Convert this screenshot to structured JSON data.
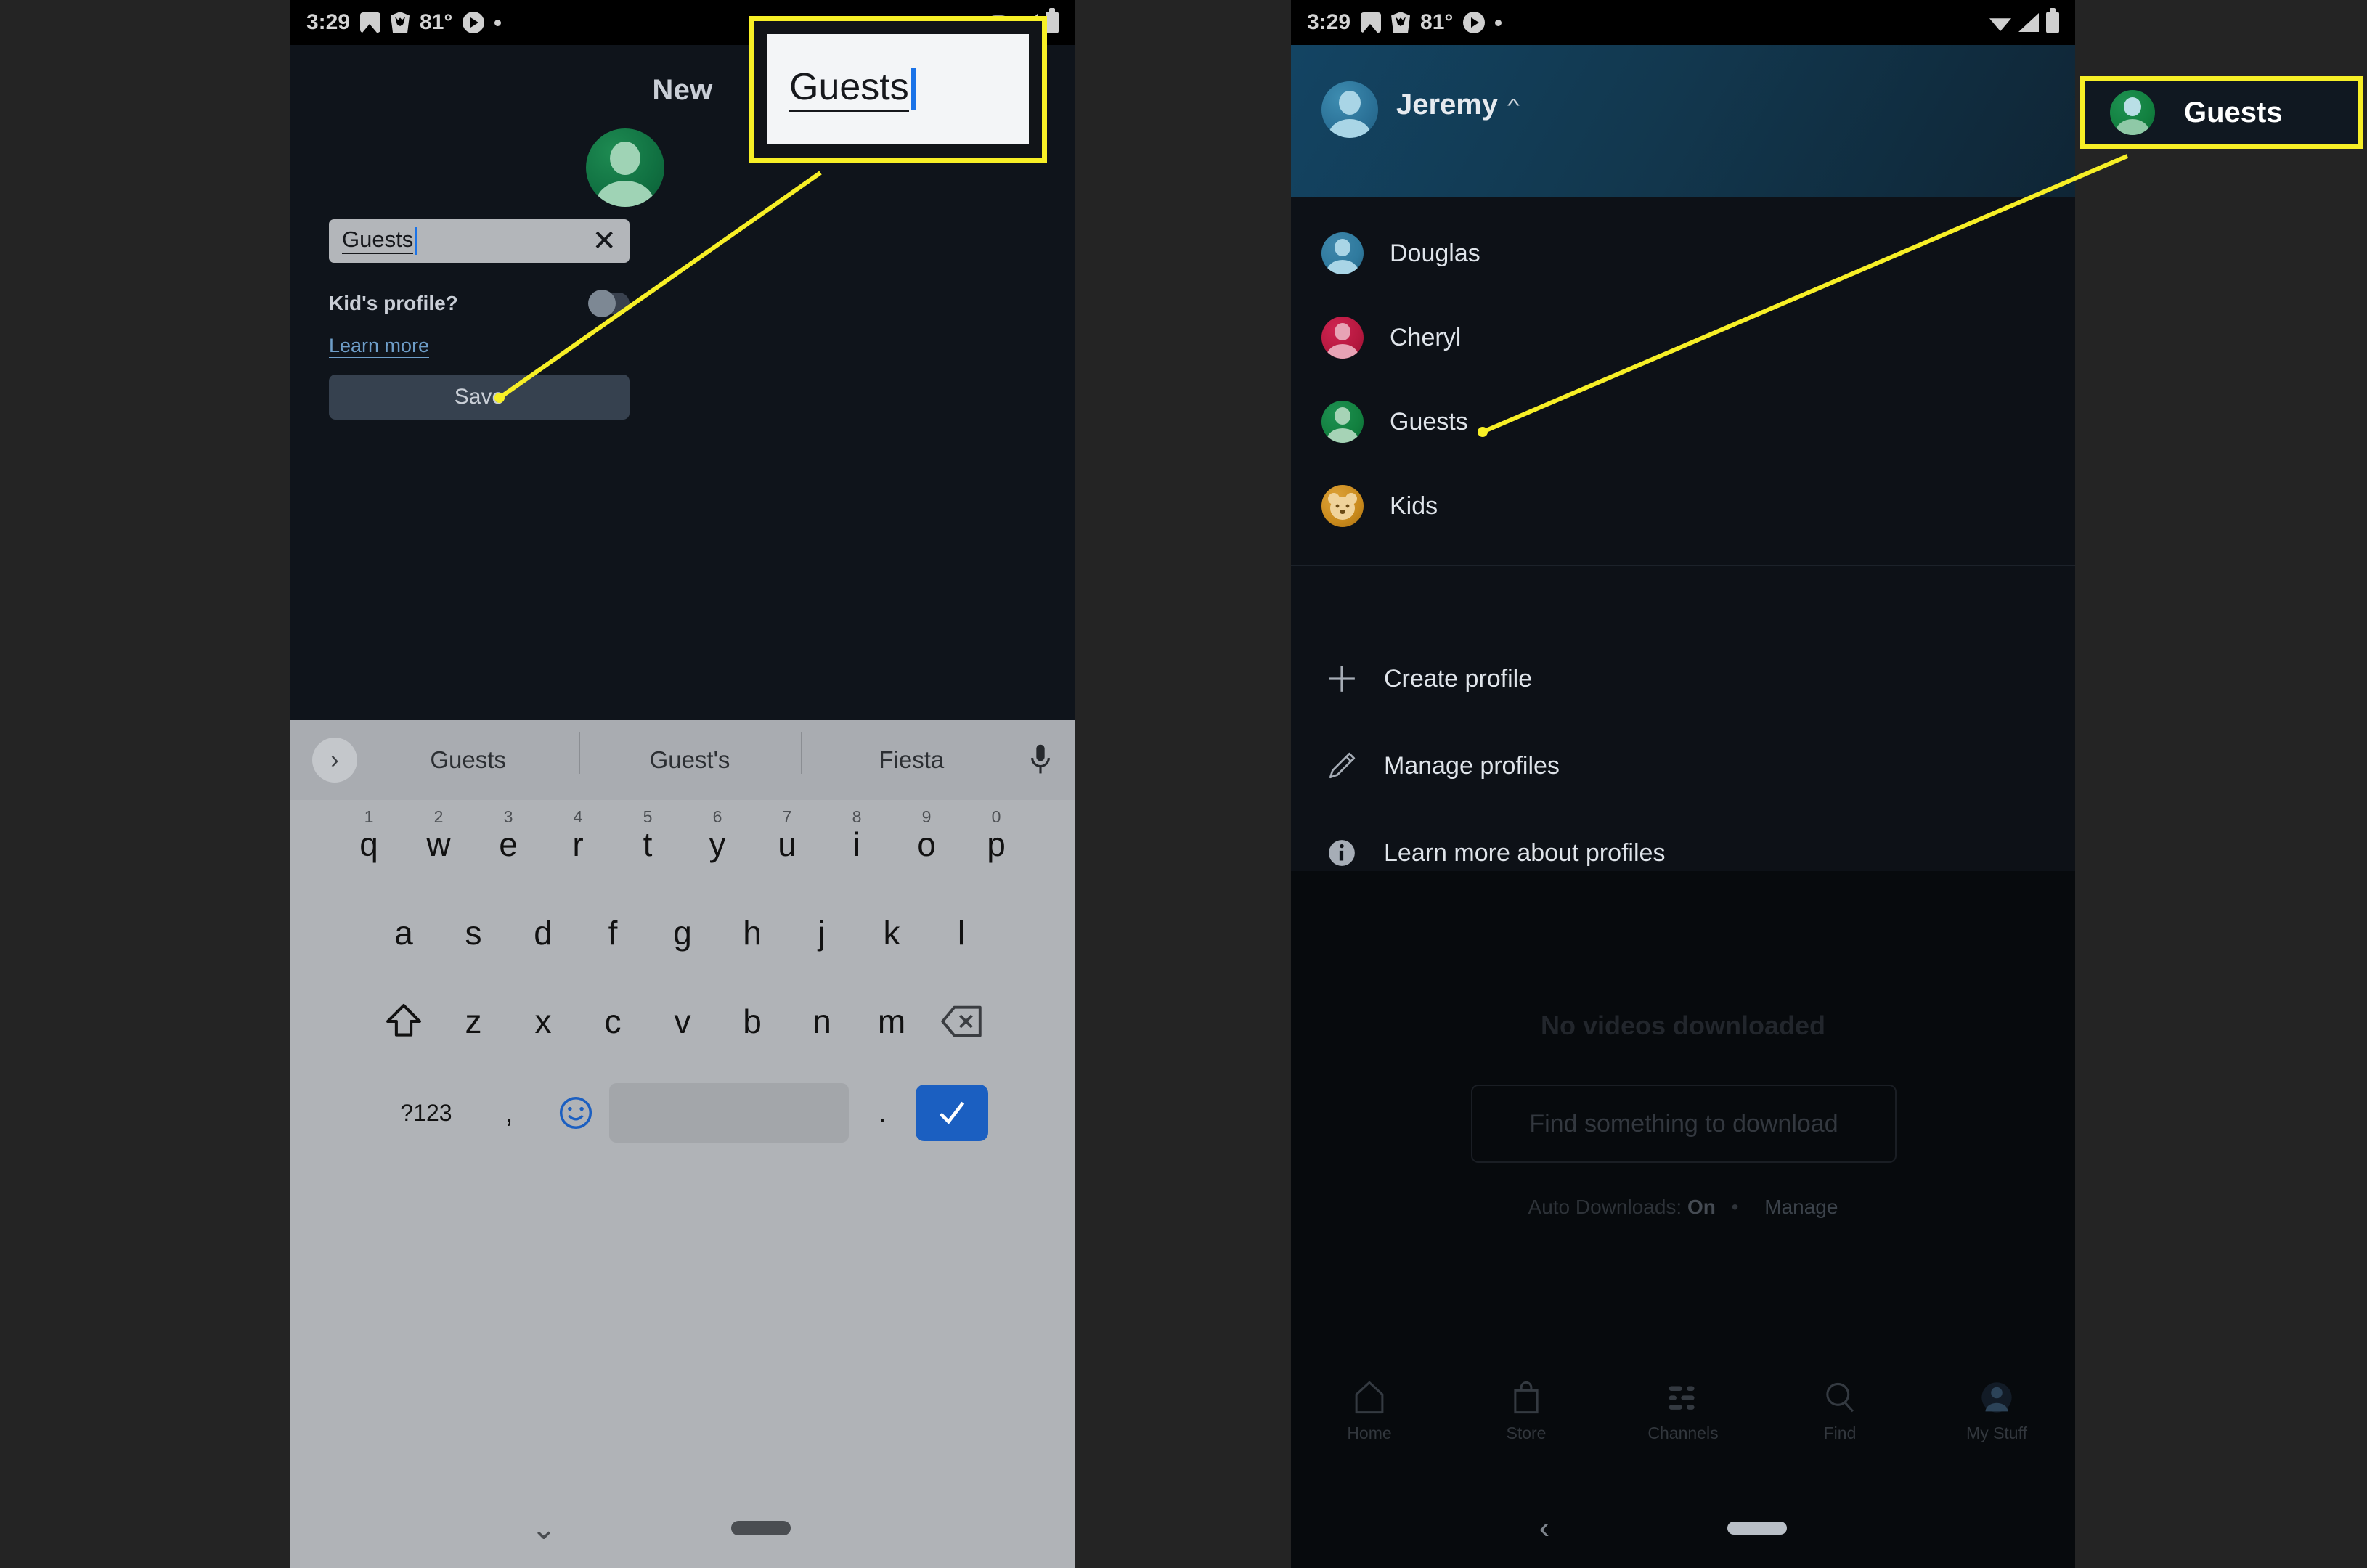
{
  "status_bar": {
    "time": "3:29",
    "temperature": "81°",
    "icons": [
      "photos-icon",
      "brave-icon",
      "play-icon",
      "dot-icon",
      "wifi-icon",
      "signal-icon",
      "battery-icon"
    ]
  },
  "left_phone": {
    "title": "New",
    "avatar": {
      "color": "#107041",
      "icon": "person-avatar-icon"
    },
    "name_input": {
      "value": "Guests",
      "clear_icon": "close-x-icon"
    },
    "kid_profile": {
      "label": "Kid's profile?",
      "toggle_state": "off"
    },
    "learn_more_link": "Learn more",
    "save_button": "Save",
    "keyboard": {
      "suggestions": [
        "Guests",
        "Guest's",
        "Fiesta"
      ],
      "expand_icon": "chevron-right-icon",
      "mic_icon": "microphone-icon",
      "row1": [
        {
          "k": "q",
          "n": "1"
        },
        {
          "k": "w",
          "n": "2"
        },
        {
          "k": "e",
          "n": "3"
        },
        {
          "k": "r",
          "n": "4"
        },
        {
          "k": "t",
          "n": "5"
        },
        {
          "k": "y",
          "n": "6"
        },
        {
          "k": "u",
          "n": "7"
        },
        {
          "k": "i",
          "n": "8"
        },
        {
          "k": "o",
          "n": "9"
        },
        {
          "k": "p",
          "n": "0"
        }
      ],
      "row2": [
        "a",
        "s",
        "d",
        "f",
        "g",
        "h",
        "j",
        "k",
        "l"
      ],
      "row3": [
        "z",
        "x",
        "c",
        "v",
        "b",
        "n",
        "m"
      ],
      "shift_icon": "shift-arrow-icon",
      "delete_icon": "backspace-icon",
      "symbols_key": "?123",
      "comma_key": ",",
      "emoji_icon": "emoji-smiley-icon",
      "space_key": "",
      "period_key": ".",
      "enter_icon": "checkmark-icon",
      "hide_keyboard_icon": "chevron-down-icon",
      "home_pill": "home-pill-indicator"
    }
  },
  "right_phone": {
    "account_name": "Jeremy",
    "account_chevron_icon": "chevron-up-icon",
    "account_avatar_color": "#2b7197",
    "profiles": [
      {
        "name": "Douglas",
        "color": "#2f7a9e",
        "face": "#a9d5e6",
        "type": "person"
      },
      {
        "name": "Cheryl",
        "color": "#b6183f",
        "face": "#e49aaf",
        "type": "person"
      },
      {
        "name": "Guests",
        "color": "#12803f",
        "face": "#a6d3b6",
        "type": "person"
      },
      {
        "name": "Kids",
        "color": "#c98a1c",
        "face": "#f0d39a",
        "type": "bear"
      }
    ],
    "menu": [
      {
        "label": "Create profile",
        "icon": "plus-icon"
      },
      {
        "label": "Manage profiles",
        "icon": "pencil-icon"
      },
      {
        "label": "Learn more about profiles",
        "icon": "info-circle-icon"
      }
    ],
    "background": {
      "heading": "No videos downloaded",
      "cta_button": "Find something to download",
      "auto_downloads_label": "Auto Downloads:",
      "auto_downloads_value": "On",
      "manage_link": "Manage"
    },
    "bottom_nav": [
      {
        "label": "Home",
        "icon": "home-icon"
      },
      {
        "label": "Store",
        "icon": "store-bag-icon"
      },
      {
        "label": "Channels",
        "icon": "channels-list-icon"
      },
      {
        "label": "Find",
        "icon": "search-icon"
      },
      {
        "label": "My Stuff",
        "icon": "my-stuff-avatar-icon"
      }
    ],
    "system_nav": {
      "back_icon": "back-chevron-icon",
      "home_pill": "home-pill-indicator"
    }
  },
  "callouts": {
    "left": {
      "text": "Guests",
      "border_color": "#f7ef26"
    },
    "right": {
      "text": "Guests",
      "border_color": "#f7ef26",
      "avatar_color": "#12803f"
    }
  }
}
